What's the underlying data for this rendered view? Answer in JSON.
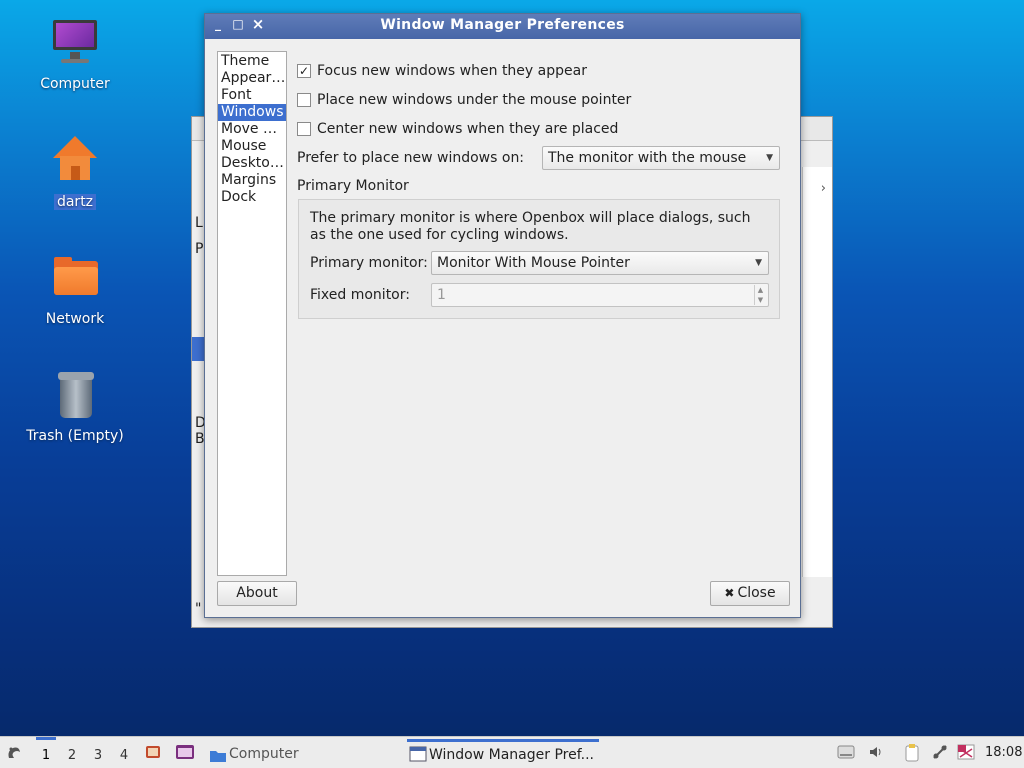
{
  "desktop": {
    "icons": [
      {
        "label": "Computer"
      },
      {
        "label": "dartz"
      },
      {
        "label": "Network"
      },
      {
        "label": "Trash (Empty)"
      }
    ]
  },
  "background_window": {
    "fragments": [
      "L",
      "P",
      "D",
      "B",
      "\""
    ],
    "chevron": "›"
  },
  "dialog": {
    "title": "Window Manager Preferences",
    "titlebar_buttons": {
      "minimize": "_",
      "maximize": "□",
      "close": "×"
    },
    "sidebar": {
      "items": [
        {
          "label": "Theme"
        },
        {
          "label": "Appearance"
        },
        {
          "label": "Font"
        },
        {
          "label": "Windows"
        },
        {
          "label": "Move & Resize"
        },
        {
          "label": "Mouse"
        },
        {
          "label": "Desktops"
        },
        {
          "label": "Margins"
        },
        {
          "label": "Dock"
        }
      ],
      "selected": "Windows"
    },
    "options": {
      "focus_new": {
        "label": "Focus new windows when they appear",
        "checked": true,
        "mark": "✓"
      },
      "place_under_mouse": {
        "label": "Place new windows under the mouse pointer",
        "checked": false
      },
      "center_new": {
        "label": "Center new windows when they are placed",
        "checked": false
      }
    },
    "prefer_place": {
      "label": "Prefer to place new windows on:",
      "value": "The monitor with the mouse"
    },
    "primary_monitor": {
      "heading": "Primary Monitor",
      "description": "The primary monitor is where Openbox will place dialogs, such as the one used for cycling windows.",
      "primary_label": "Primary monitor:",
      "primary_value": "Monitor With Mouse Pointer",
      "fixed_label": "Fixed monitor:",
      "fixed_value": "1"
    },
    "buttons": {
      "about": "About",
      "close": "Close",
      "close_icon": "✖"
    }
  },
  "taskbar": {
    "workspaces": [
      "1",
      "2",
      "3",
      "4"
    ],
    "active_workspace": "1",
    "tasks": [
      {
        "label": "Computer"
      },
      {
        "label": "Window Manager Pref..."
      }
    ],
    "clock": "18:08"
  }
}
